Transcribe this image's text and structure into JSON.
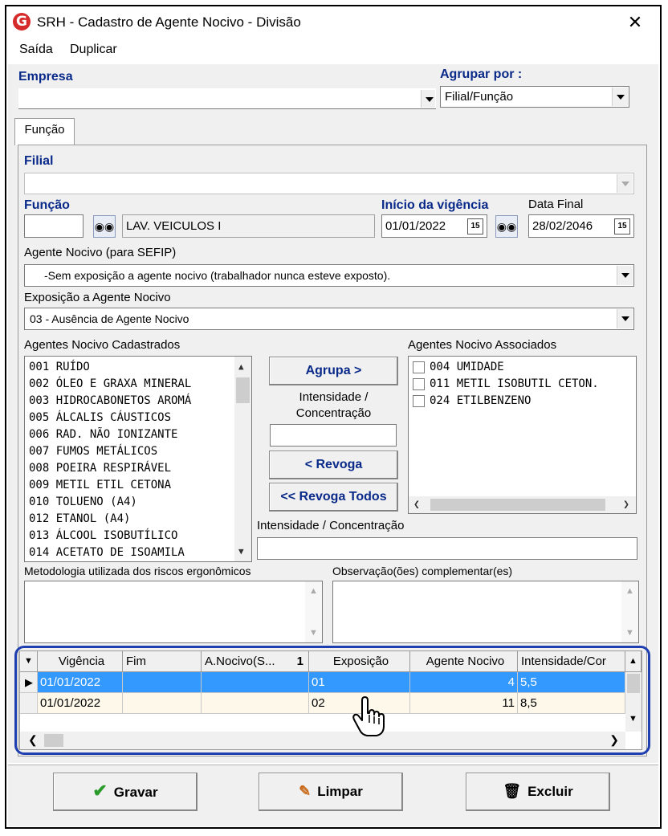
{
  "window": {
    "title": "SRH - Cadastro de Agente Nocivo - Divisão",
    "logo": "G",
    "close": "✕"
  },
  "menu": {
    "items": [
      "Saída",
      "Duplicar"
    ]
  },
  "empresa": {
    "label": "Empresa",
    "value": ""
  },
  "agrupar": {
    "label": "Agrupar por :",
    "value": "Filial/Função"
  },
  "tab": {
    "label": "Função"
  },
  "filial": {
    "label": "Filial",
    "value": ""
  },
  "funcao": {
    "label": "Função",
    "code": "",
    "name": "LAV. VEICULOS I"
  },
  "inicio": {
    "label": "Início da vigência",
    "value": "01/01/2022",
    "cal": "15"
  },
  "datafinal": {
    "label": "Data Final",
    "value": "28/02/2046",
    "cal": "15"
  },
  "agente_sefip": {
    "label": "Agente Nocivo (para SEFIP)",
    "value": "-Sem exposição a agente nocivo (trabalhador nunca esteve exposto)."
  },
  "exposicao": {
    "label": "Exposição a Agente Nocivo",
    "value": "03 - Ausência de Agente Nocivo"
  },
  "cadastrados": {
    "label": "Agentes Nocivo Cadastrados",
    "items": [
      "001 RUÍDO",
      "002 ÓLEO E GRAXA MINERAL",
      "003 HIDROCABONETOS AROMÁ",
      "005 ÁLCALIS CÁUSTICOS",
      "006 RAD. NÃO IONIZANTE",
      "007 FUMOS METÁLICOS",
      "008 POEIRA RESPIRÁVEL",
      "009 METIL ETIL CETONA",
      "010 TOLUENO (A4)",
      "012 ETANOL (A4)",
      "013 ÁLCOOL ISOBUTÍLICO",
      "014 ACETATO DE ISOAMILA"
    ]
  },
  "middle": {
    "agrupa": "Agrupa >",
    "intensidade_label": "Intensidade / Concentração",
    "intensidade_value": "",
    "revoga": "< Revoga",
    "revoga_todos": "<< Revoga Todos"
  },
  "associados": {
    "label": "Agentes Nocivo Associados",
    "items": [
      "004 UMIDADE",
      "011 METIL ISOBUTIL CETON.",
      "024 ETILBENZENO"
    ]
  },
  "intensidade2": {
    "label": "Intensidade / Concentração",
    "value": ""
  },
  "metodologia": {
    "label": "Metodologia utilizada dos riscos ergonômicos",
    "value": ""
  },
  "observacao": {
    "label": "Observação(ões) complementar(es)",
    "value": ""
  },
  "grid": {
    "headers": [
      "Vigência",
      "Fim",
      "A.Nocivo(S...",
      "Exposição",
      "Agente Nocivo",
      "Intensidade/Cor"
    ],
    "sort_marker": "1",
    "rows": [
      [
        "01/01/2022",
        "",
        "",
        "01",
        "4",
        "5,5"
      ],
      [
        "01/01/2022",
        "",
        "",
        "02",
        "11",
        "8,5"
      ]
    ]
  },
  "buttons": {
    "gravar": "Gravar",
    "limpar": "Limpar",
    "excluir": "Excluir"
  },
  "colors": {
    "label_blue": "#0a2a8a",
    "selection": "#3399ff",
    "highlight_border": "#1f3fb0",
    "logo_red": "#d62b2b"
  }
}
